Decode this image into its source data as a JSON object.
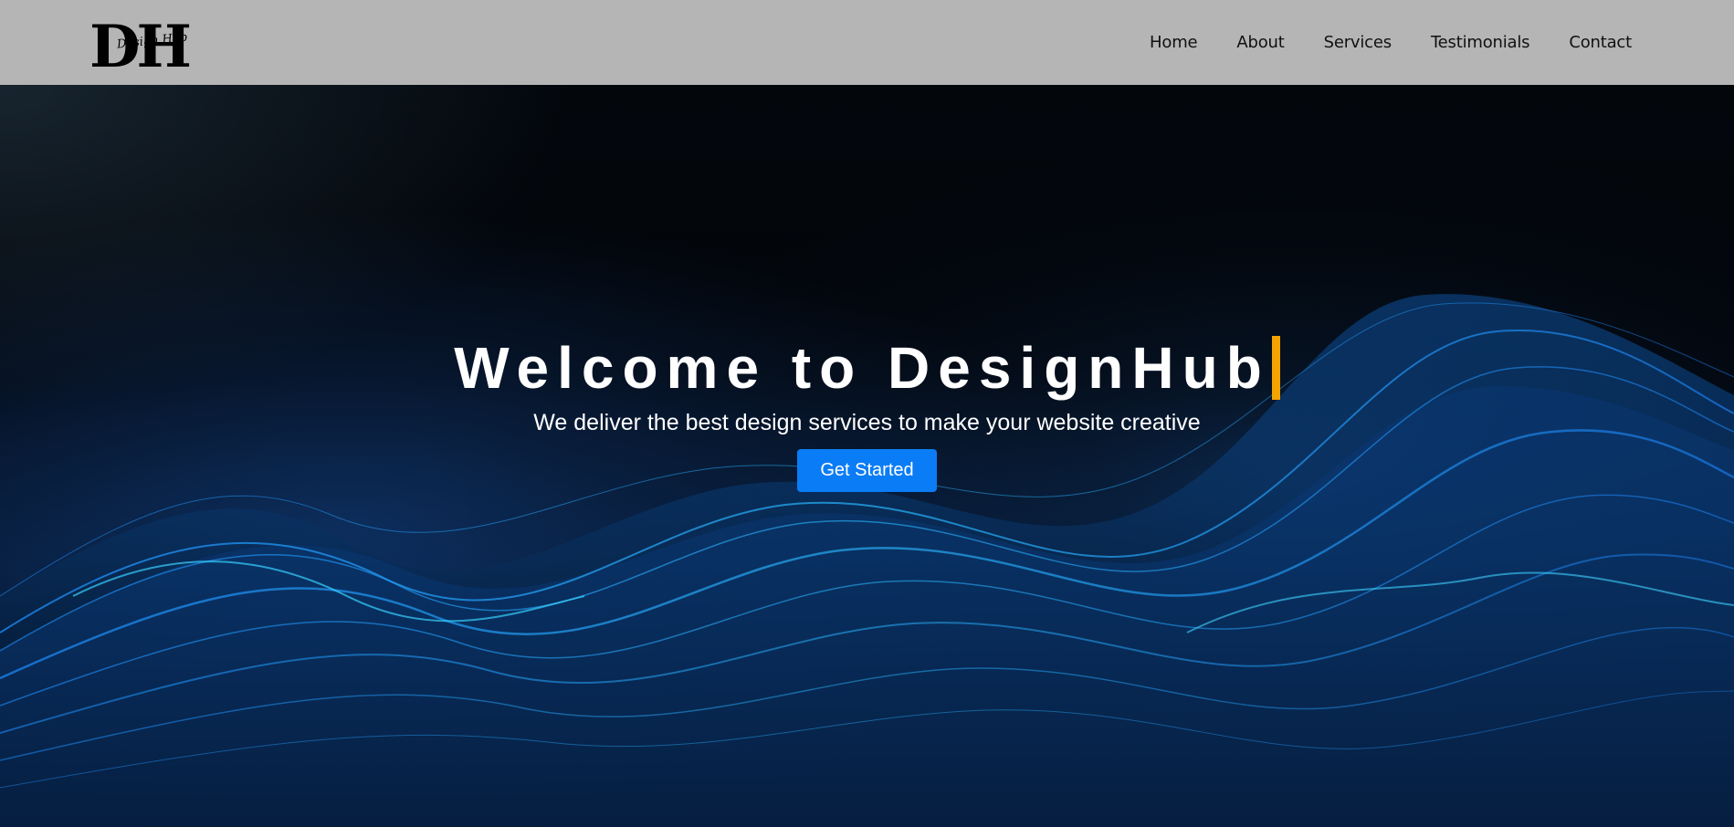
{
  "brand": {
    "logo_letters": "DH",
    "logo_script": "Design Hub"
  },
  "nav": {
    "items": [
      {
        "label": "Home"
      },
      {
        "label": "About"
      },
      {
        "label": "Services"
      },
      {
        "label": "Testimonials"
      },
      {
        "label": "Contact"
      }
    ]
  },
  "hero": {
    "title": "Welcome to DesignHub",
    "subtitle": "We deliver the best design services to make your website creative",
    "cta_label": "Get Started"
  },
  "colors": {
    "navbar_bg": "#b5b5b5",
    "cta_bg": "#0a7cf5",
    "cursor": "#f5a300",
    "hero_text": "#ffffff"
  }
}
